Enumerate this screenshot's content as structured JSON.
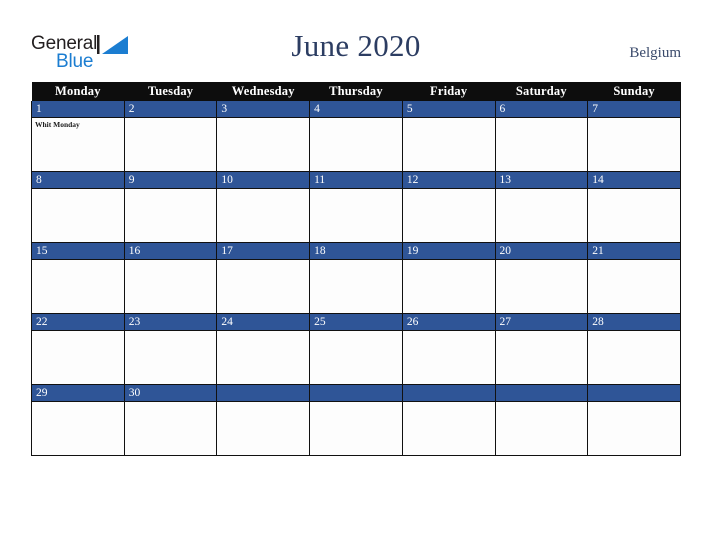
{
  "brand": {
    "name_part1": "General",
    "name_part2": "Blue",
    "mark_icon": "triangle-logo-icon",
    "color_dark": "#231f20",
    "color_blue": "#1b7dd1"
  },
  "header": {
    "title": "June 2020",
    "country": "Belgium",
    "title_color": "#2c3d62"
  },
  "calendar": {
    "weekday_headers": [
      "Monday",
      "Tuesday",
      "Wednesday",
      "Thursday",
      "Friday",
      "Saturday",
      "Sunday"
    ],
    "accent_color": "#2f5597",
    "header_bg": "#0d0d0d",
    "weeks": [
      [
        {
          "day": "1",
          "events": [
            "Whit Monday"
          ]
        },
        {
          "day": "2",
          "events": []
        },
        {
          "day": "3",
          "events": []
        },
        {
          "day": "4",
          "events": []
        },
        {
          "day": "5",
          "events": []
        },
        {
          "day": "6",
          "events": []
        },
        {
          "day": "7",
          "events": []
        }
      ],
      [
        {
          "day": "8",
          "events": []
        },
        {
          "day": "9",
          "events": []
        },
        {
          "day": "10",
          "events": []
        },
        {
          "day": "11",
          "events": []
        },
        {
          "day": "12",
          "events": []
        },
        {
          "day": "13",
          "events": []
        },
        {
          "day": "14",
          "events": []
        }
      ],
      [
        {
          "day": "15",
          "events": []
        },
        {
          "day": "16",
          "events": []
        },
        {
          "day": "17",
          "events": []
        },
        {
          "day": "18",
          "events": []
        },
        {
          "day": "19",
          "events": []
        },
        {
          "day": "20",
          "events": []
        },
        {
          "day": "21",
          "events": []
        }
      ],
      [
        {
          "day": "22",
          "events": []
        },
        {
          "day": "23",
          "events": []
        },
        {
          "day": "24",
          "events": []
        },
        {
          "day": "25",
          "events": []
        },
        {
          "day": "26",
          "events": []
        },
        {
          "day": "27",
          "events": []
        },
        {
          "day": "28",
          "events": []
        }
      ],
      [
        {
          "day": "29",
          "events": []
        },
        {
          "day": "30",
          "events": []
        },
        {
          "day": "",
          "events": []
        },
        {
          "day": "",
          "events": []
        },
        {
          "day": "",
          "events": []
        },
        {
          "day": "",
          "events": []
        },
        {
          "day": "",
          "events": []
        }
      ]
    ]
  }
}
